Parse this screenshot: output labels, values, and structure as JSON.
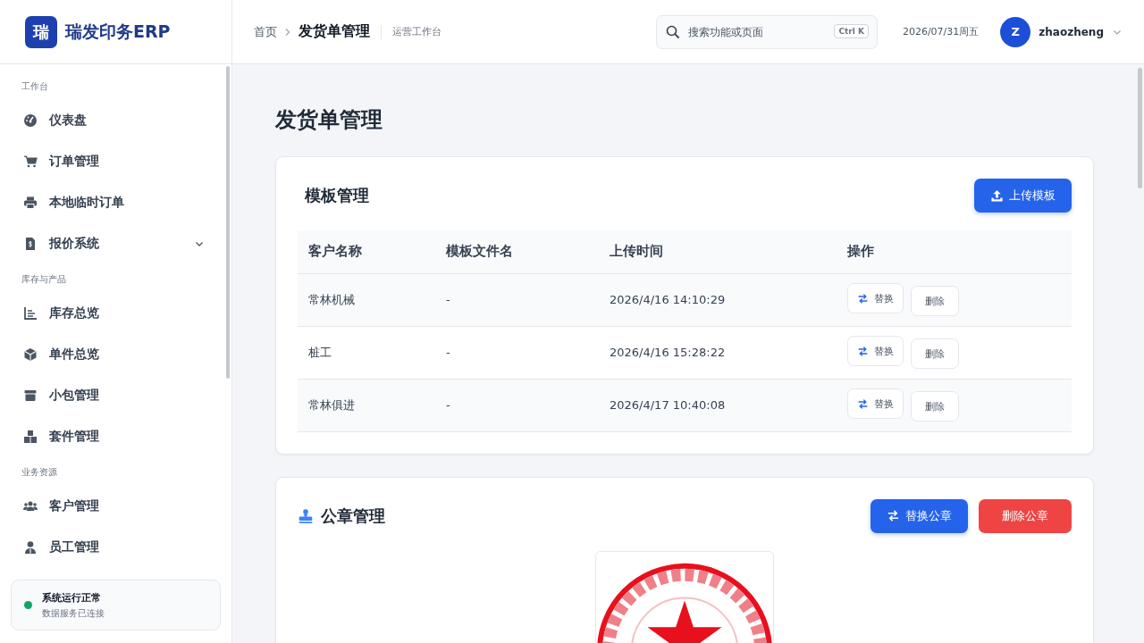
{
  "brand": {
    "logo_char": "瑞",
    "name": "瑞发印务ERP"
  },
  "sidebar": {
    "groups": [
      {
        "title": "工作台",
        "items": [
          {
            "label": "仪表盘",
            "kind": "gauge"
          },
          {
            "label": "订单管理",
            "kind": "cart"
          },
          {
            "label": "本地临时订单",
            "kind": "printer"
          },
          {
            "label": "报价系统",
            "kind": "invoice",
            "expanded": false
          }
        ]
      },
      {
        "title": "库存与产品",
        "items": [
          {
            "label": "库存总览",
            "kind": "chart"
          },
          {
            "label": "单件总览",
            "kind": "cube"
          },
          {
            "label": "小包管理",
            "kind": "box"
          },
          {
            "label": "套件管理",
            "kind": "boxes"
          }
        ]
      },
      {
        "title": "业务资源",
        "items": [
          {
            "label": "客户管理",
            "kind": "users"
          },
          {
            "label": "员工管理",
            "kind": "user"
          }
        ]
      }
    ],
    "status": {
      "ok": true,
      "title": "系统运行正常",
      "subtitle": "数据服务已连接"
    }
  },
  "header": {
    "breadcrumb": [
      "首页",
      "发货单管理"
    ],
    "workspace": "运营工作台",
    "search": {
      "placeholder": "搜索功能或页面",
      "shortcut": "Ctrl K"
    },
    "date": "2026/07/31周五",
    "user": {
      "initial": "Z",
      "name": "zhaozheng"
    }
  },
  "page": {
    "title": "发货单管理"
  },
  "template_card": {
    "title": "模板管理",
    "upload_button": "上传模板",
    "table": {
      "columns": [
        "客户名称",
        "模板文件名",
        "上传时间",
        "操作"
      ],
      "rows": [
        {
          "customer": "常林机械",
          "file": "-",
          "time": "2026/4/16 14:10:29",
          "actions": [
            "替换",
            "删除"
          ]
        },
        {
          "customer": "桩工",
          "file": "-",
          "time": "2026/4/16 15:28:22",
          "actions": [
            "替换",
            "删除"
          ]
        },
        {
          "customer": "常林俱进",
          "file": "-",
          "time": "2026/4/17 10:40:08",
          "actions": [
            "替换",
            "删除"
          ]
        }
      ]
    }
  },
  "seal_card": {
    "title": "公章管理",
    "replace_button": "替换公章",
    "delete_button": "删除公章"
  }
}
